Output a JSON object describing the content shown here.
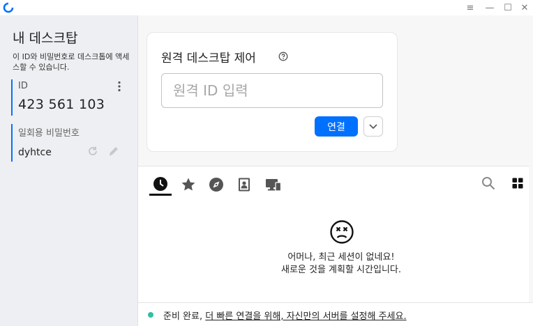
{
  "colors": {
    "accent": "#0071ff",
    "status_ok": "#32bea6",
    "sidebar_bg": "#eeeff2"
  },
  "titlebar": {
    "icons": [
      "app-logo-icon",
      "menu-icon",
      "minimize-icon",
      "maximize-icon",
      "close-icon"
    ],
    "menu_glyph": "≡",
    "minimize_glyph": "—",
    "maximize_glyph": "☐",
    "close_glyph": "✕"
  },
  "sidebar": {
    "title": "내 데스크탑",
    "description": "이 ID와 비밀번호로 데스크톱에 액세스할 수 있습니다.",
    "id_label": "ID",
    "id_value": "423 561 103",
    "password_label": "일회용 비밀번호",
    "password_value": "dyhtce"
  },
  "connect_card": {
    "title": "원격 데스크탑 제어",
    "input_placeholder": "원격 ID 입력",
    "connect_label": "연결"
  },
  "tabs": [
    {
      "name": "recent-sessions",
      "icon": "clock-icon"
    },
    {
      "name": "favorites",
      "icon": "star-icon"
    },
    {
      "name": "discovered",
      "icon": "compass-icon"
    },
    {
      "name": "address-book",
      "icon": "contact-book-icon"
    },
    {
      "name": "devices",
      "icon": "devices-icon"
    }
  ],
  "empty_state": {
    "line1": "어머나, 최근 세션이 없네요!",
    "line2": "새로운 것을 계획할 시간입니다."
  },
  "status": {
    "ready": "준비 완료,",
    "link": "더 빠른 연결을 위해, 자신만의 서버를 설정해 주세요."
  }
}
